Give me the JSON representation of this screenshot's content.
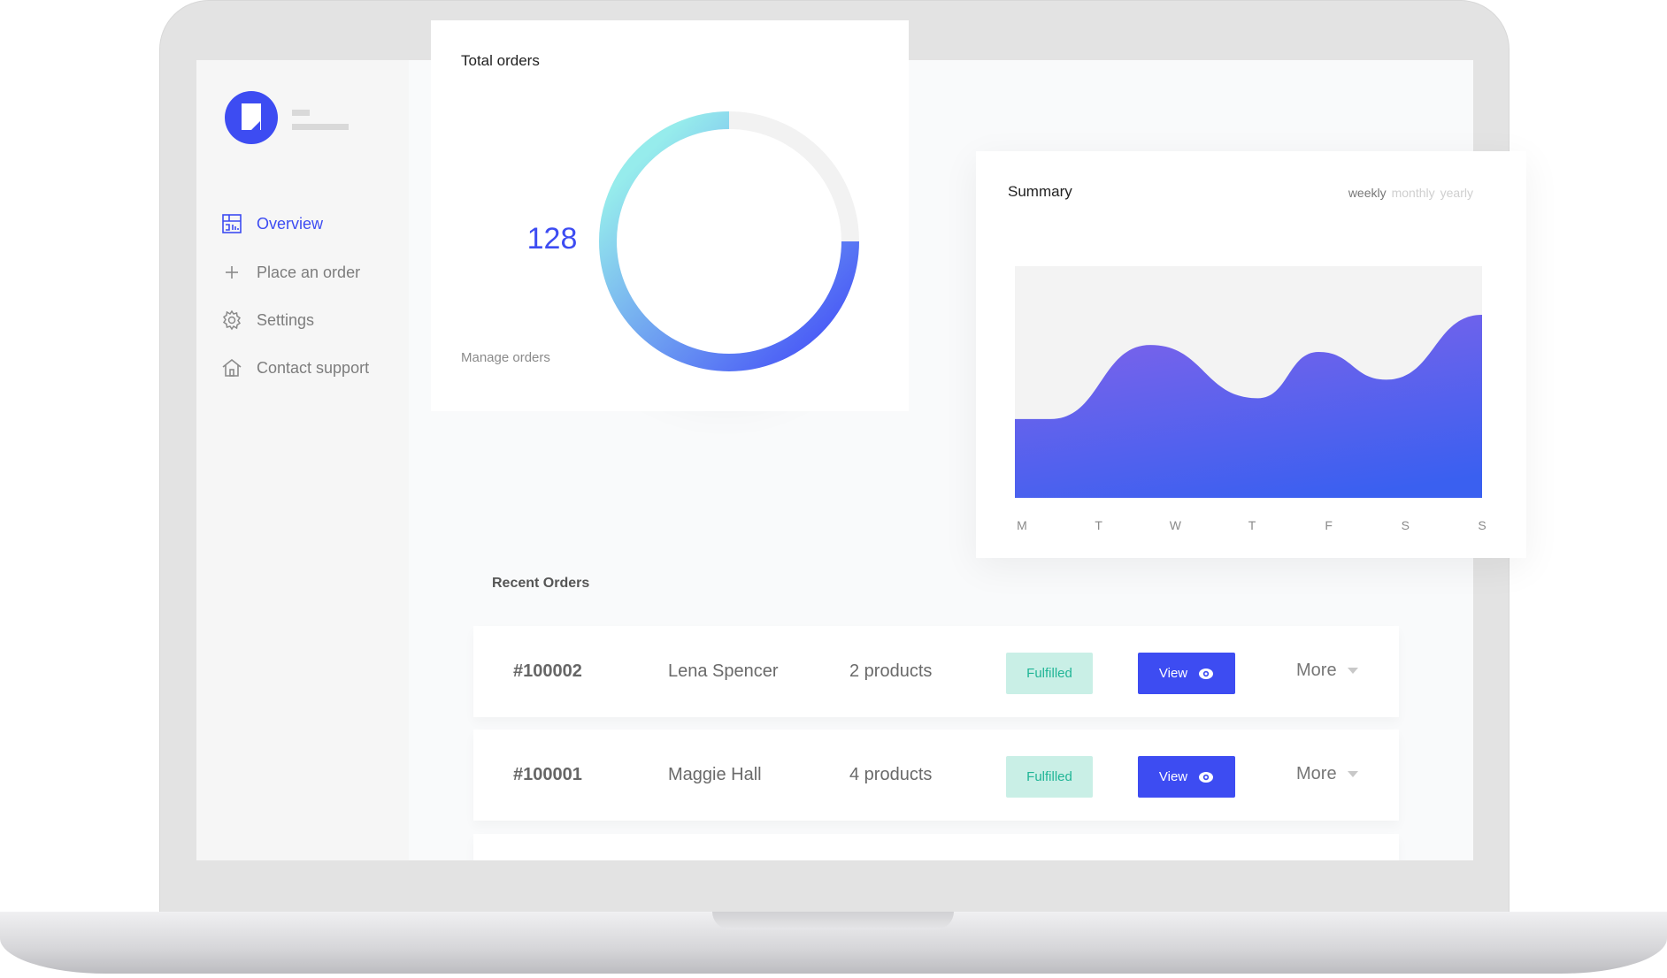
{
  "sidebar": {
    "brand_color": "#3d4cf2",
    "items": [
      {
        "label": "Overview",
        "icon": "dashboard-icon",
        "active": true
      },
      {
        "label": "Place an order",
        "icon": "plus-icon",
        "active": false
      },
      {
        "label": "Settings",
        "icon": "gear-icon",
        "active": false
      },
      {
        "label": "Contact support",
        "icon": "home-icon",
        "active": false
      }
    ]
  },
  "total_orders": {
    "title": "Total orders",
    "count": "128",
    "progress_percent": 75,
    "link": "Manage orders",
    "gradient": [
      "#96ecec",
      "#4a5bf6"
    ]
  },
  "summary": {
    "title": "Summary",
    "periods": [
      {
        "label": "weekly",
        "active": true
      },
      {
        "label": "monthly",
        "active": false
      },
      {
        "label": "yearly",
        "active": false
      }
    ]
  },
  "chart_data": {
    "type": "area",
    "title": "Summary",
    "categories": [
      "M",
      "T",
      "W",
      "T",
      "F",
      "S",
      "S"
    ],
    "points": [
      {
        "x": 0,
        "y": 34
      },
      {
        "x": 0.46,
        "y": 34
      },
      {
        "x": 1.74,
        "y": 66
      },
      {
        "x": 3.12,
        "y": 43
      },
      {
        "x": 3.9,
        "y": 63
      },
      {
        "x": 4.77,
        "y": 51
      },
      {
        "x": 6,
        "y": 79
      }
    ],
    "ylim": [
      0,
      100
    ],
    "grid": false,
    "colors": {
      "top": "#7d63ea",
      "bottom": "#3a60f0",
      "background": "#f3f3f3"
    }
  },
  "recent_orders": {
    "title": "Recent Orders",
    "rows": [
      {
        "id": "#100002",
        "customer": "Lena Spencer",
        "products": "2 products",
        "status": "Fulfilled",
        "view": "View",
        "more": "More"
      },
      {
        "id": "#100001",
        "customer": "Maggie Hall",
        "products": "4 products",
        "status": "Fulfilled",
        "view": "View",
        "more": "More"
      }
    ]
  }
}
